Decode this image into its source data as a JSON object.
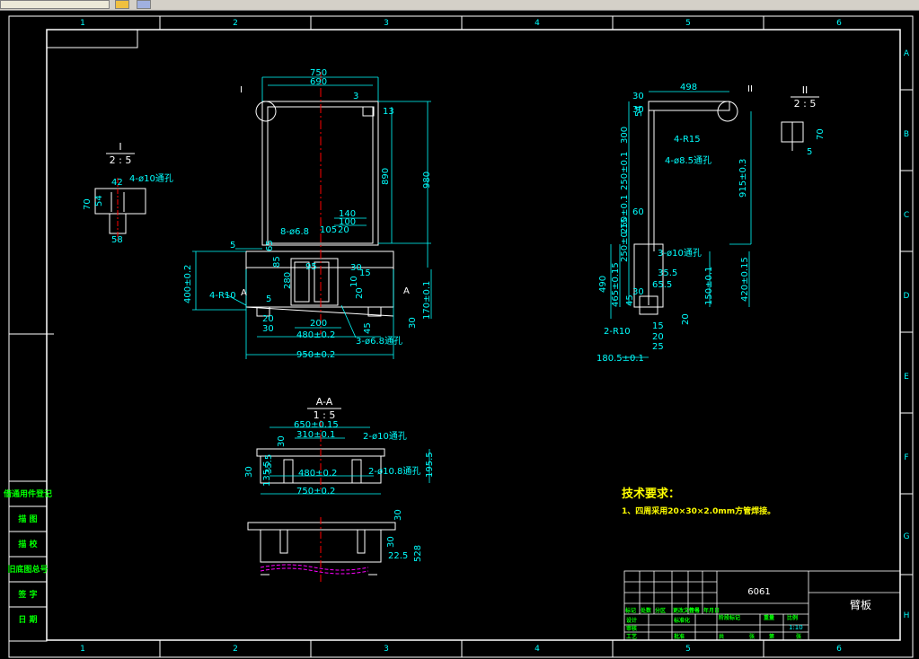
{
  "window": {
    "title": ""
  },
  "frame": {
    "col_numbers": [
      "1",
      "2",
      "3",
      "4",
      "5",
      "6"
    ],
    "row_letters": [
      "A",
      "B",
      "C",
      "D",
      "E",
      "F",
      "G",
      "H"
    ]
  },
  "views": {
    "detail_I": {
      "title": "I",
      "scale": "2 : 5",
      "dims": [
        "42",
        "4-ø10通孔",
        "70",
        "54",
        "58"
      ]
    },
    "detail_II": {
      "title": "II",
      "scale": "2 : 5",
      "dims": [
        "70",
        "5"
      ]
    },
    "section_AA": {
      "title": "A-A",
      "scale": "1 : 5",
      "dims": [
        "650±0.15",
        "310±0.1",
        "30",
        "2-ø10通孔",
        "30",
        "35.5",
        "480±0.2",
        "2-ø10.8通孔",
        "195.5",
        "135.5",
        "750±0.2"
      ]
    },
    "front": {
      "callout": "I",
      "dims": [
        "750",
        "690",
        "3",
        "13",
        "890",
        "980",
        "140",
        "100",
        "105",
        "20",
        "8-ø6.8",
        "5",
        "65",
        "85",
        "95",
        "30",
        "15",
        "10",
        "20",
        "280",
        "400±0.2",
        "4-R10",
        "5",
        "20",
        "30",
        "200",
        "480±0.2",
        "45",
        "3-ø6.8通孔",
        "30",
        "170±0.1",
        "950±0.2"
      ],
      "section_mark": "A"
    },
    "side": {
      "callout": "II",
      "dims": [
        "30",
        "498",
        "54",
        "30",
        "300",
        "4-R15",
        "4-ø8.5通孔",
        "250±0.1",
        "250±0.1",
        "60",
        "915±0.3",
        "250±0.15",
        "3-ø10通孔",
        "35.5",
        "490",
        "465±0.15",
        "65.5",
        "150±0.1",
        "420±0.15",
        "30",
        "45",
        "15",
        "20",
        "2-R10",
        "20",
        "25",
        "180.5±0.1"
      ]
    },
    "bottom": {
      "dims": [
        "30",
        "30",
        "22.5",
        "528"
      ]
    }
  },
  "tech": {
    "heading": "技术要求：",
    "note": "1、四周采用20×30×2.0mm方管焊接。"
  },
  "side_table": {
    "rows": [
      "借通用件登记",
      "描 图",
      "描 校",
      "旧底图总号",
      "签 字",
      "日 期"
    ]
  },
  "title_block": {
    "material": "6061",
    "part_name": "臂板",
    "scale": "1:10",
    "labels": [
      "标记",
      "处数",
      "分区",
      "更改文件号",
      "签名",
      "年月日",
      "阶段标记",
      "重量",
      "比例",
      "设计",
      "标准化",
      "审核",
      "工艺",
      "批准",
      "共",
      "张",
      "第",
      "张"
    ]
  },
  "colors": {
    "background": "#000000",
    "frame": "#ffffff",
    "dimension": "#00ffff",
    "text_green": "#00ff00",
    "text_yellow": "#ffff00",
    "centerline": "#ff0000",
    "hidden": "#ff00ff"
  }
}
